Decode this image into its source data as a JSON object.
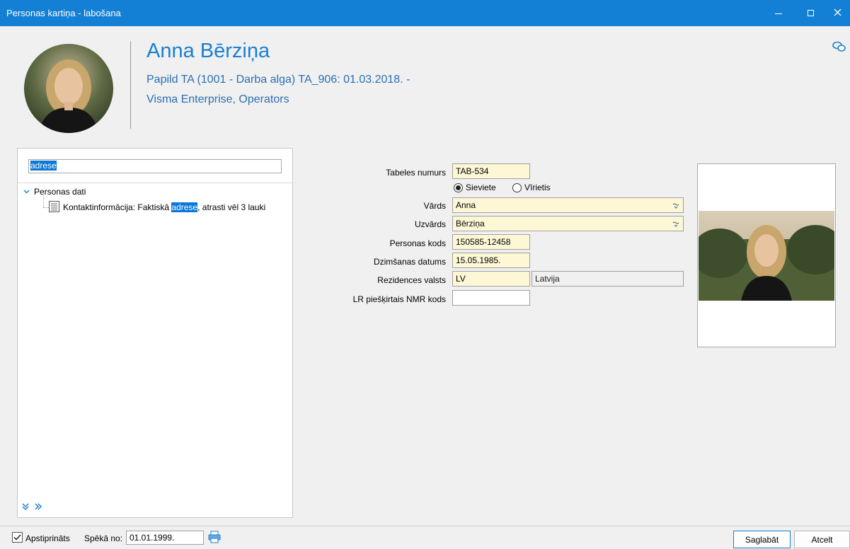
{
  "window": {
    "title": "Personas kartiņa - labošana"
  },
  "header": {
    "name": "Anna Bērziņa",
    "line1": "Papild TA (1001 - Darba alga) TA_906: 01.03.2018. -",
    "line2": "Visma Enterprise, Operators"
  },
  "search": {
    "value": "adrese"
  },
  "tree": {
    "root_label": "Personas dati",
    "child_prefix": "Kontaktinformācija: Faktiskā ",
    "child_highlight": "adrese",
    "child_suffix": ", atrasti vēl 3 lauki"
  },
  "form": {
    "tabeles_numurs": {
      "label": "Tabeles numurs",
      "value": "TAB-534"
    },
    "gender": {
      "options": [
        {
          "label": "Sieviete",
          "selected": true
        },
        {
          "label": "Vīrietis",
          "selected": false
        }
      ]
    },
    "vards": {
      "label": "Vārds",
      "value": "Anna"
    },
    "uzvards": {
      "label": "Uzvārds",
      "value": "Bērziņa"
    },
    "personas_kods": {
      "label": "Personas kods",
      "value": "150585-12458"
    },
    "dzimsanas_datums": {
      "label": "Dzimšanas datums",
      "value": "15.05.1985."
    },
    "rezidences_valsts": {
      "label": "Rezidences valsts",
      "code": "LV",
      "name": "Latvija"
    },
    "nmr_kods": {
      "label": "LR piešķirtais NMR kods",
      "value": ""
    }
  },
  "footer": {
    "approved_label": "Apstiprināts",
    "approved": true,
    "valid_from_label": "Spēkā no:",
    "valid_from_value": "01.01.1999.",
    "save_label": "Saglabāt",
    "cancel_label": "Atcelt"
  },
  "colors": {
    "titlebar": "#1380d6",
    "accent": "#1a7fd0",
    "required_field": "#fdf7d6",
    "highlight": "#0a78d7"
  },
  "icons": {
    "window_minimize": "minimize-icon",
    "window_maximize": "maximize-icon",
    "window_close": "close-icon",
    "chat": "chat-bubbles-icon",
    "tree_expand": "chevron-down-icon",
    "tree_node": "document-list-icon",
    "dropdown": "dropdown-icon",
    "expand_all": "double-chevron-down-icon",
    "next": "double-chevron-right-icon",
    "print": "printer-icon"
  }
}
